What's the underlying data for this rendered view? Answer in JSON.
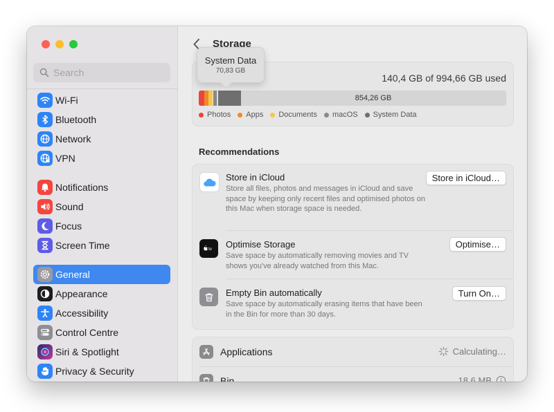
{
  "sidebar": {
    "search_placeholder": "Search",
    "items": [
      {
        "label": "Wi-Fi",
        "icon": "wifi-icon",
        "color": "#2e84f6"
      },
      {
        "label": "Bluetooth",
        "icon": "bluetooth-icon",
        "color": "#2e84f6"
      },
      {
        "label": "Network",
        "icon": "globe-icon",
        "color": "#2e84f6"
      },
      {
        "label": "VPN",
        "icon": "vpn-globe-icon",
        "color": "#2e84f6"
      },
      {
        "label": "Notifications",
        "icon": "bell-icon",
        "color": "#f4453f"
      },
      {
        "label": "Sound",
        "icon": "speaker-icon",
        "color": "#f4453f"
      },
      {
        "label": "Focus",
        "icon": "moon-icon",
        "color": "#5e5ce6"
      },
      {
        "label": "Screen Time",
        "icon": "hourglass-icon",
        "color": "#5e5ce6"
      },
      {
        "label": "General",
        "icon": "gear-icon",
        "color": "#8e8e93"
      },
      {
        "label": "Appearance",
        "icon": "appearance-icon",
        "color": "#1d1d1f"
      },
      {
        "label": "Accessibility",
        "icon": "accessibility-icon",
        "color": "#2e84f6"
      },
      {
        "label": "Control Centre",
        "icon": "control-centre-icon",
        "color": "#8e8e93"
      },
      {
        "label": "Siri & Spotlight",
        "icon": "siri-icon",
        "color": "#7a3ad6"
      },
      {
        "label": "Privacy & Security",
        "icon": "hand-icon",
        "color": "#2e84f6"
      }
    ],
    "selected": "General"
  },
  "main": {
    "title": "Storage",
    "usage": {
      "summary": "140,4 GB of 994,66 GB used",
      "free_label": "854,26 GB",
      "legend": [
        {
          "label": "Photos",
          "color": "#e8463c"
        },
        {
          "label": "Apps",
          "color": "#ef8a2c"
        },
        {
          "label": "Documents",
          "color": "#f2c94a"
        },
        {
          "label": "macOS",
          "color": "#8a8a8a"
        },
        {
          "label": "System Data",
          "color": "#6f6f6f"
        }
      ],
      "tooltip": {
        "title": "System Data",
        "size": "70,83 GB"
      }
    },
    "recommendations_title": "Recommendations",
    "recommendations": [
      {
        "title": "Store in iCloud",
        "description": "Store all files, photos and messages in iCloud and save space by keeping only recent files and optimised photos on this Mac when storage space is needed.",
        "button": "Store in iCloud…",
        "icon": "icloud-icon"
      },
      {
        "title": "Optimise Storage",
        "description": "Save space by automatically removing movies and TV shows you've already watched from this Mac.",
        "button": "Optimise…",
        "icon": "apple-tv-icon"
      },
      {
        "title": "Empty Bin automatically",
        "description": "Save space by automatically erasing items that have been in the Bin for more than 30 days.",
        "button": "Turn On…",
        "icon": "bin-icon"
      }
    ],
    "categories": [
      {
        "label": "Applications",
        "value": "Calculating…",
        "icon": "applications-icon"
      },
      {
        "label": "Bin",
        "value": "18,6 MB",
        "icon": "bin-icon"
      }
    ]
  }
}
